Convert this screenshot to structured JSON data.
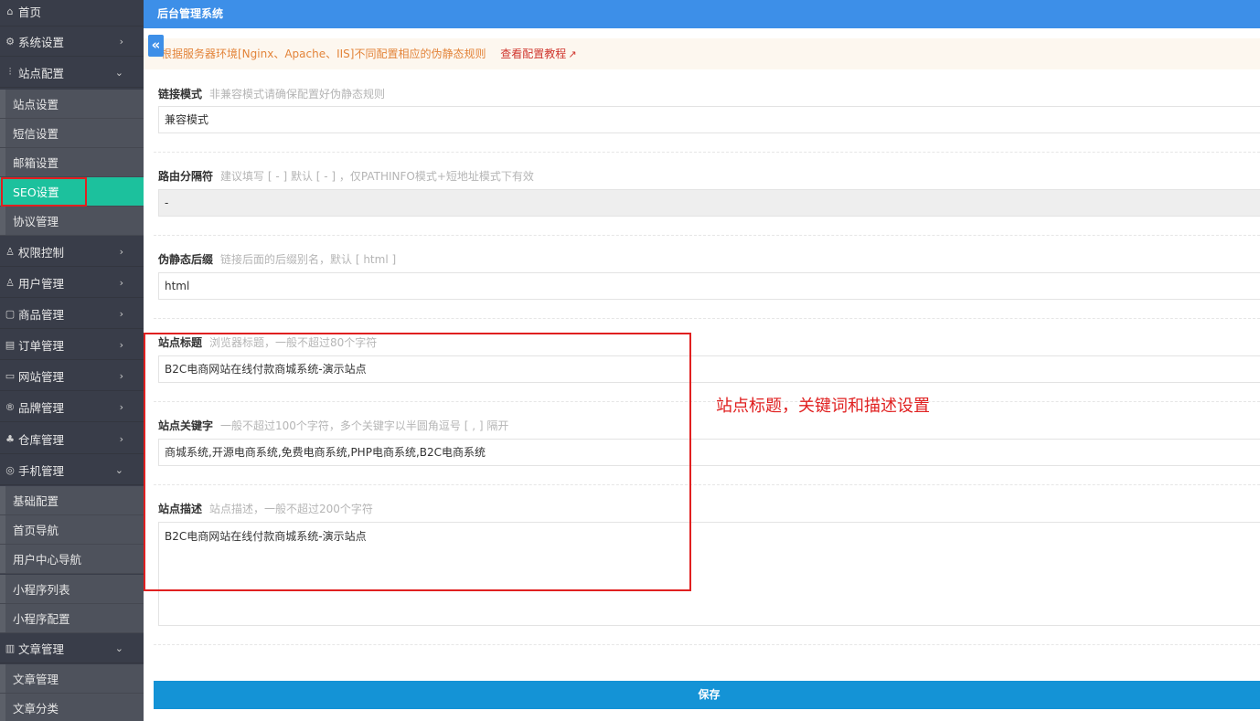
{
  "app": {
    "title": "后台管理系统",
    "collapse_icon": "«"
  },
  "sidebar": {
    "menus": [
      {
        "id": "home",
        "icon": "⌂",
        "label": "首页",
        "arrow": ""
      },
      {
        "id": "system",
        "icon": "⚙",
        "label": "系统设置",
        "arrow": "›"
      },
      {
        "id": "site-config",
        "icon": "⫶",
        "label": "站点配置",
        "arrow": "⌄"
      },
      {
        "id": "permission",
        "icon": "♙",
        "label": "权限控制",
        "arrow": "›"
      },
      {
        "id": "user",
        "icon": "♙",
        "label": "用户管理",
        "arrow": "›"
      },
      {
        "id": "goods",
        "icon": "▢",
        "label": "商品管理",
        "arrow": "›"
      },
      {
        "id": "order",
        "icon": "▤",
        "label": "订单管理",
        "arrow": "›"
      },
      {
        "id": "website",
        "icon": "▭",
        "label": "网站管理",
        "arrow": "›"
      },
      {
        "id": "brand",
        "icon": "®",
        "label": "品牌管理",
        "arrow": "›"
      },
      {
        "id": "warehouse",
        "icon": "♣",
        "label": "仓库管理",
        "arrow": "›"
      },
      {
        "id": "mobile",
        "icon": "◎",
        "label": "手机管理",
        "arrow": "⌄"
      },
      {
        "id": "article",
        "icon": "▥",
        "label": "文章管理",
        "arrow": "⌄"
      }
    ],
    "site_config_sub": [
      "站点设置",
      "短信设置",
      "邮箱设置",
      "SEO设置",
      "协议管理"
    ],
    "mobile_sub": [
      "基础配置",
      "首页导航",
      "用户中心导航",
      "小程序列表",
      "小程序配置"
    ],
    "article_sub": [
      "文章管理",
      "文章分类"
    ],
    "active_item": "SEO设置",
    "active_color": "#1cc19d"
  },
  "notice": {
    "text": "根据服务器环境[Nginx、Apache、IIS]不同配置相应的伪静态规则",
    "link": "查看配置教程",
    "link_icon": "↗"
  },
  "form": {
    "link_mode": {
      "label": "链接模式",
      "hint": "非兼容模式请确保配置好伪静态规则",
      "value": "兼容模式"
    },
    "route_sep": {
      "label": "路由分隔符",
      "hint": "建议填写 [ - ] 默认 [ - ] ，仅PATHINFO模式+短地址模式下有效",
      "value": "-"
    },
    "suffix": {
      "label": "伪静态后缀",
      "hint": "链接后面的后缀别名，默认 [ html ]",
      "value": "html"
    },
    "site_title": {
      "label": "站点标题",
      "hint": "浏览器标题，一般不超过80个字符",
      "value": "B2C电商网站在线付款商城系统-演示站点"
    },
    "site_keywords": {
      "label": "站点关键字",
      "hint": "一般不超过100个字符，多个关键字以半圆角逗号 [ , ] 隔开",
      "value": "商城系统,开源电商系统,免费电商系统,PHP电商系统,B2C电商系统"
    },
    "site_desc": {
      "label": "站点描述",
      "hint": "站点描述，一般不超过200个字符",
      "value": "B2C电商网站在线付款商城系统-演示站点"
    },
    "save_label": "保存"
  },
  "annotation": "站点标题，关键词和描述设置",
  "colors": {
    "header": "#3d8fe8",
    "save": "#1493d6",
    "highlight": "#e02020",
    "sidebar": "#393d49"
  }
}
